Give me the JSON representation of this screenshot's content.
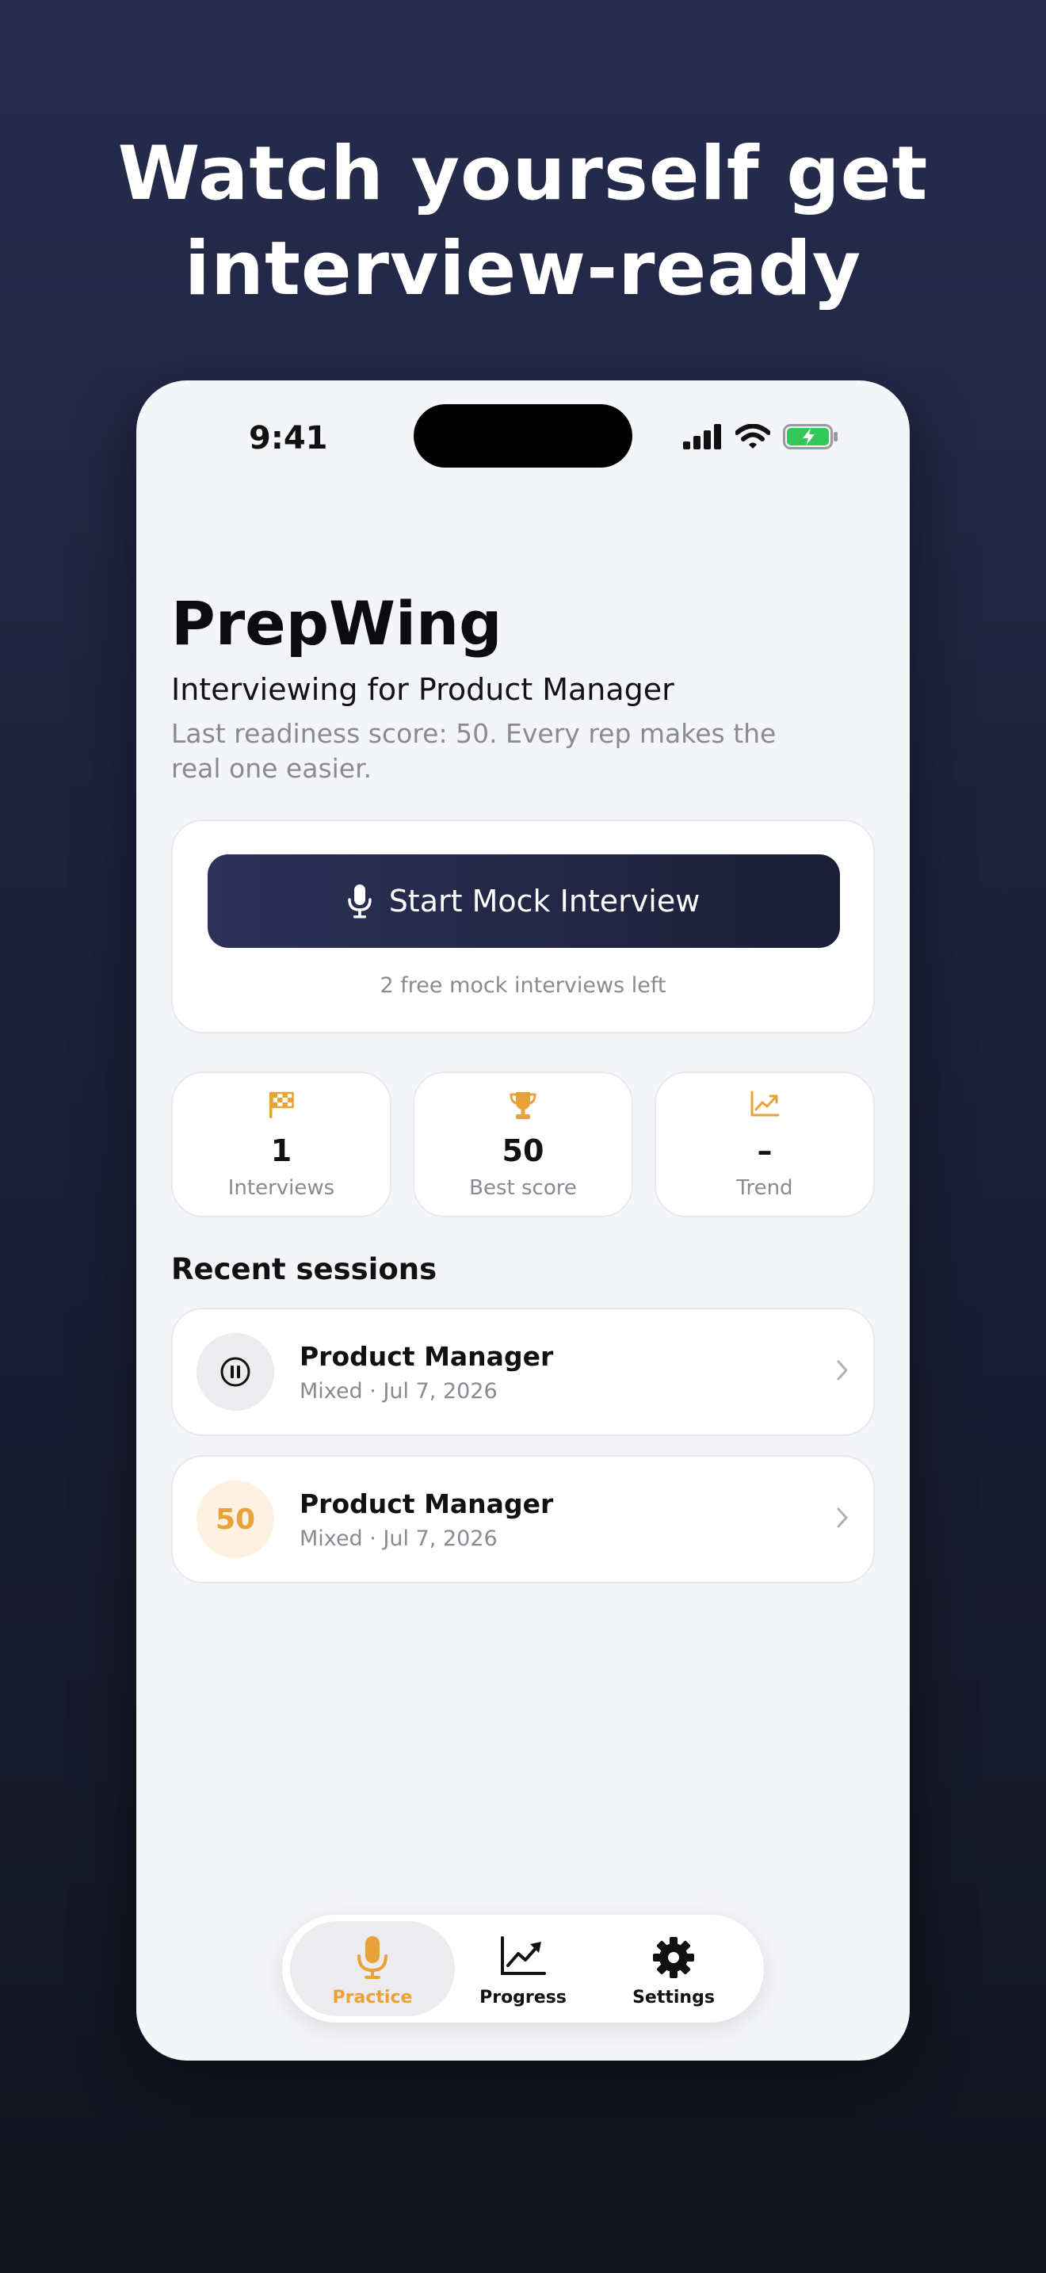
{
  "headline": {
    "line1": "Watch yourself get",
    "line2": "interview-ready"
  },
  "status_bar": {
    "time": "9:41"
  },
  "app": {
    "title": "PrepWing",
    "subtitle": "Interviewing for Product Manager",
    "description": "Last readiness score: 50. Every rep makes the real one easier."
  },
  "start_card": {
    "button_label": "Start Mock Interview",
    "note": "2 free mock interviews left"
  },
  "stats": [
    {
      "icon": "checkered-flag-icon",
      "value": "1",
      "label": "Interviews"
    },
    {
      "icon": "trophy-icon",
      "value": "50",
      "label": "Best score"
    },
    {
      "icon": "trend-chart-icon",
      "value": "–",
      "label": "Trend"
    }
  ],
  "recent": {
    "title": "Recent sessions",
    "sessions": [
      {
        "badge_icon": "pause-icon",
        "badge_text": "",
        "title": "Product Manager",
        "meta": "Mixed · Jul 7, 2026"
      },
      {
        "badge_icon": "",
        "badge_text": "50",
        "title": "Product Manager",
        "meta": "Mixed · Jul 7, 2026"
      }
    ]
  },
  "tabbar": {
    "tabs": [
      {
        "label": "Practice",
        "icon": "microphone-icon",
        "active": true
      },
      {
        "label": "Progress",
        "icon": "chart-up-icon",
        "active": false
      },
      {
        "label": "Settings",
        "icon": "gear-icon",
        "active": false
      }
    ]
  },
  "colors": {
    "accent": "#e8a23a",
    "button_dark": "#1f2340",
    "battery_green": "#34c759",
    "muted_text": "#8a8a92"
  }
}
